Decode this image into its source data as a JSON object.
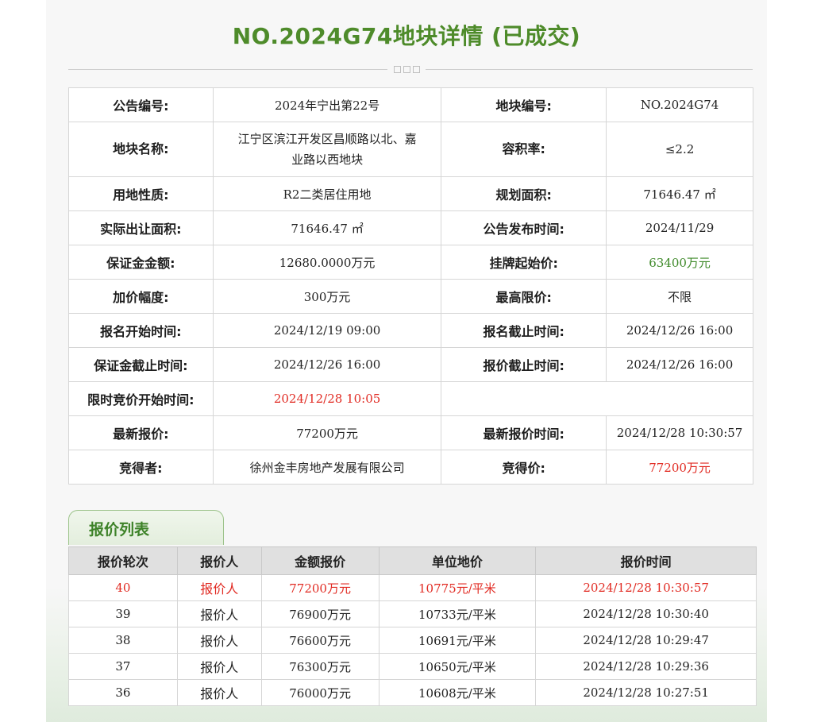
{
  "page_title": "NO.2024G74地块详情 (已成交)",
  "colors": {
    "accent_green": "#4e8b2a",
    "highlight_red": "#e12a22"
  },
  "details": [
    {
      "l1": "公告编号:",
      "v1": "2024年宁出第22号",
      "l2": "地块编号:",
      "v2": "NO.2024G74"
    },
    {
      "l1": "地块名称:",
      "v1": "江宁区滨江开发区昌顺路以北、嘉业路以西地块",
      "l2": "容积率:",
      "v2": "≤2.2"
    },
    {
      "l1": "用地性质:",
      "v1": "R2二类居住用地",
      "l2": "规划面积:",
      "v2": "71646.47 ㎡"
    },
    {
      "l1": "实际出让面积:",
      "v1": "71646.47 ㎡",
      "l2": "公告发布时间:",
      "v2": "2024/11/29"
    },
    {
      "l1": "保证金金额:",
      "v1": "12680.0000万元",
      "l2": "挂牌起始价:",
      "v2": "63400万元"
    },
    {
      "l1": "加价幅度:",
      "v1": "300万元",
      "l2": "最高限价:",
      "v2": "不限"
    },
    {
      "l1": "报名开始时间:",
      "v1": "2024/12/19 09:00",
      "l2": "报名截止时间:",
      "v2": "2024/12/26 16:00"
    },
    {
      "l1": "保证金截止时间:",
      "v1": "2024/12/26 16:00",
      "l2": "报价截止时间:",
      "v2": "2024/12/26 16:00"
    },
    {
      "l1": "限时竞价开始时间:",
      "v1": "2024/12/28 10:05",
      "l2": "",
      "v2": ""
    },
    {
      "l1": "最新报价:",
      "v1": "77200万元",
      "l2": "最新报价时间:",
      "v2": "2024/12/28 10:30:57"
    },
    {
      "l1": "竞得者:",
      "v1": "徐州金丰房地产发展有限公司",
      "l2": "竞得价:",
      "v2": "77200万元"
    }
  ],
  "bid_list": {
    "tab_label": "报价列表",
    "headers": [
      "报价轮次",
      "报价人",
      "金额报价",
      "单位地价",
      "报价时间"
    ],
    "rows": [
      {
        "round": "40",
        "bidder": "报价人",
        "amount": "77200万元",
        "unit_price": "10775元/平米",
        "time": "2024/12/28 10:30:57"
      },
      {
        "round": "39",
        "bidder": "报价人",
        "amount": "76900万元",
        "unit_price": "10733元/平米",
        "time": "2024/12/28 10:30:40"
      },
      {
        "round": "38",
        "bidder": "报价人",
        "amount": "76600万元",
        "unit_price": "10691元/平米",
        "time": "2024/12/28 10:29:47"
      },
      {
        "round": "37",
        "bidder": "报价人",
        "amount": "76300万元",
        "unit_price": "10650元/平米",
        "time": "2024/12/28 10:29:36"
      },
      {
        "round": "36",
        "bidder": "报价人",
        "amount": "76000万元",
        "unit_price": "10608元/平米",
        "time": "2024/12/28 10:27:51"
      }
    ]
  }
}
